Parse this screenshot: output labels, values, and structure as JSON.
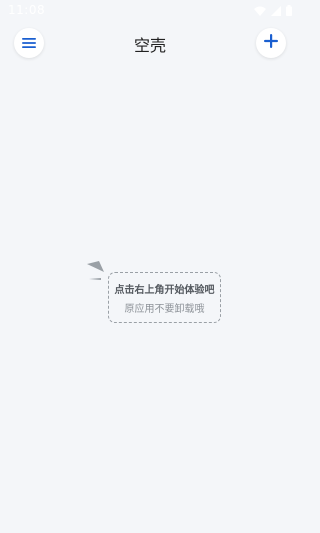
{
  "status_bar": {
    "time": "11:08",
    "icons": [
      "wifi-icon",
      "cellular-signal-icon",
      "battery-icon"
    ]
  },
  "app_bar": {
    "title": "空壳",
    "menu_icon": "hamburger-menu-icon",
    "add_icon": "plus-icon"
  },
  "empty_state": {
    "title": "点击右上角开始体验吧",
    "subtitle": "原应用不要卸载哦"
  },
  "colors": {
    "background": "#f4f6f9",
    "accent": "#1a5fd0",
    "dashed_border": "#9aa0a6"
  }
}
